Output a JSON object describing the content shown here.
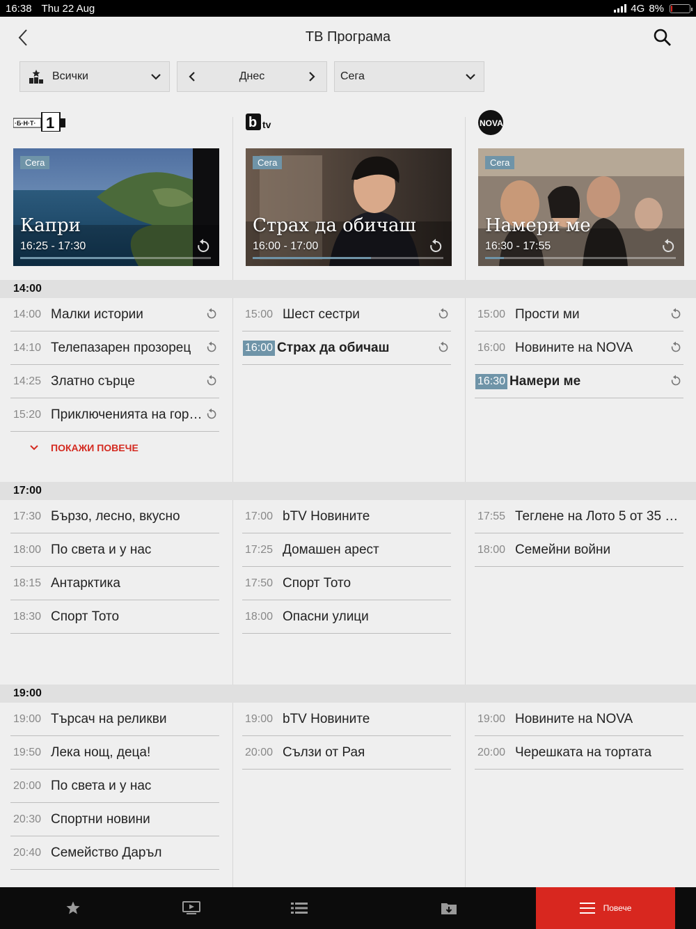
{
  "status": {
    "time": "16:38",
    "date": "Thu 22 Aug",
    "network": "4G",
    "battery": "8%",
    "battery_level": 0.08
  },
  "header": {
    "title": "ТВ Програма"
  },
  "filters": {
    "category": "Всички",
    "day": "Днес",
    "time": "Сега"
  },
  "channels": [
    {
      "name": "БНТ 1",
      "now": {
        "badge": "Сега",
        "title": "Капри",
        "time": "16:25 - 17:30",
        "progress": 0.6
      }
    },
    {
      "name": "bTV",
      "now": {
        "badge": "Сега",
        "title": "Страх да обичаш",
        "time": "16:00 - 17:00",
        "progress": 0.62
      }
    },
    {
      "name": "NOVA",
      "now": {
        "badge": "Сега",
        "title": "Намери ме",
        "time": "16:30 - 17:55",
        "progress": 0.1
      }
    }
  ],
  "hours": [
    "14:00",
    "17:00",
    "19:00"
  ],
  "schedule": {
    "h14": [
      [
        {
          "time": "14:00",
          "name": "Малки истории"
        },
        {
          "time": "14:10",
          "name": "Телепазарен прозорец"
        },
        {
          "time": "14:25",
          "name": "Златно сърце"
        },
        {
          "time": "15:20",
          "name": "Приключенията на горс…"
        }
      ],
      [
        {
          "time": "15:00",
          "name": "Шест сестри"
        },
        {
          "time": "16:00",
          "name": "Страх да обичаш"
        }
      ],
      [
        {
          "time": "15:00",
          "name": "Прости ми"
        },
        {
          "time": "16:00",
          "name": "Новините на NOVA"
        },
        {
          "time": "16:30",
          "name": "Намери ме"
        }
      ]
    ],
    "h17": [
      [
        {
          "time": "17:30",
          "name": "Бързо, лесно, вкусно"
        },
        {
          "time": "18:00",
          "name": "По света и у нас"
        },
        {
          "time": "18:15",
          "name": "Антарктика"
        },
        {
          "time": "18:30",
          "name": "Спорт Тото"
        }
      ],
      [
        {
          "time": "17:00",
          "name": "bTV Новините"
        },
        {
          "time": "17:25",
          "name": "Домашен арест"
        },
        {
          "time": "17:50",
          "name": "Спорт Тото"
        },
        {
          "time": "18:00",
          "name": "Опасни улици"
        }
      ],
      [
        {
          "time": "17:55",
          "name": "Теглене на Лото 5 от 35 - \"…"
        },
        {
          "time": "18:00",
          "name": "Семейни войни"
        }
      ]
    ],
    "h19": [
      [
        {
          "time": "19:00",
          "name": "Търсач на реликви"
        },
        {
          "time": "19:50",
          "name": "Лека нощ, деца!"
        },
        {
          "time": "20:00",
          "name": "По света и у нас"
        },
        {
          "time": "20:30",
          "name": "Спортни новини"
        },
        {
          "time": "20:40",
          "name": "Семейство Даръл"
        }
      ],
      [
        {
          "time": "19:00",
          "name": "bTV Новините"
        },
        {
          "time": "20:00",
          "name": "Сълзи от Рая"
        }
      ],
      [
        {
          "time": "19:00",
          "name": "Новините на NOVA"
        },
        {
          "time": "20:00",
          "name": "Черешката на тортата"
        }
      ]
    ]
  },
  "show_more": "ПОКАЖИ ПОВЕЧЕ",
  "tabs": {
    "more_label": "Повече"
  },
  "colors": {
    "accent": "#d8271f",
    "now_badge": "#6f94a8"
  }
}
